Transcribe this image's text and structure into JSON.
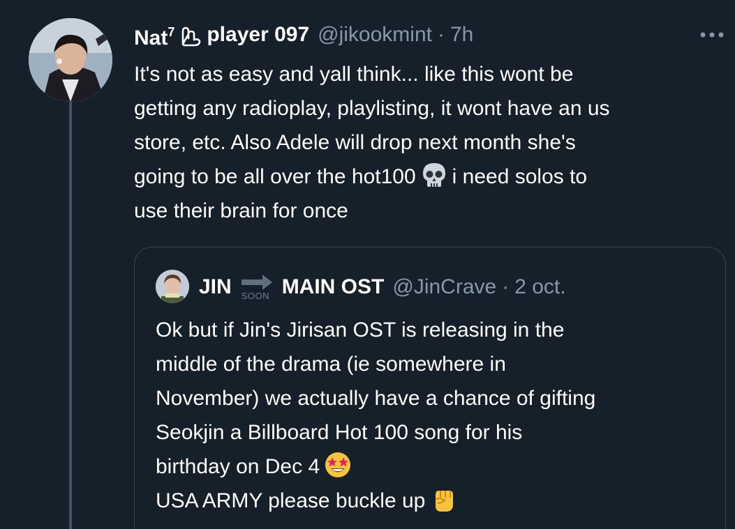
{
  "tweet": {
    "display_name": "Nat",
    "name_superscript": "7",
    "name_suffix": "player 097",
    "handle": "@jikookmint",
    "separator": "·",
    "time": "7h",
    "more_icon": "more-horizontal-icon",
    "text_lines": [
      "It's not as easy and yall think... like this wont be",
      "getting any radioplay, playlisting, it wont have an us",
      "store, etc. Also Adele will drop next month she's",
      "going to be all over the hot100",
      "i need solos to",
      "use their brain for once"
    ],
    "emoji": "skull-emoji"
  },
  "quote": {
    "name_part1": "JIN",
    "arrow_icon": "right-arrow-icon",
    "arrow_caption": "SOON",
    "name_part2": "MAIN OST",
    "handle": "@JinCrave",
    "separator": "·",
    "time": "2 oct.",
    "text_lines": [
      "Ok but if Jin's Jirisan OST is releasing in the",
      "middle of the drama (ie somewhere in",
      "November) we actually have a chance of gifting",
      "Seokjin a Billboard Hot 100 song for his",
      "birthday on Dec 4",
      "USA ARMY please buckle up"
    ],
    "emoji_1": "star-struck-emoji",
    "emoji_2": "raised-fist-emoji"
  },
  "colors": {
    "background": "#15202b",
    "text_primary": "#ffffff",
    "text_secondary": "#8899a6",
    "border": "#38444d",
    "thread_line": "#3d5466"
  }
}
